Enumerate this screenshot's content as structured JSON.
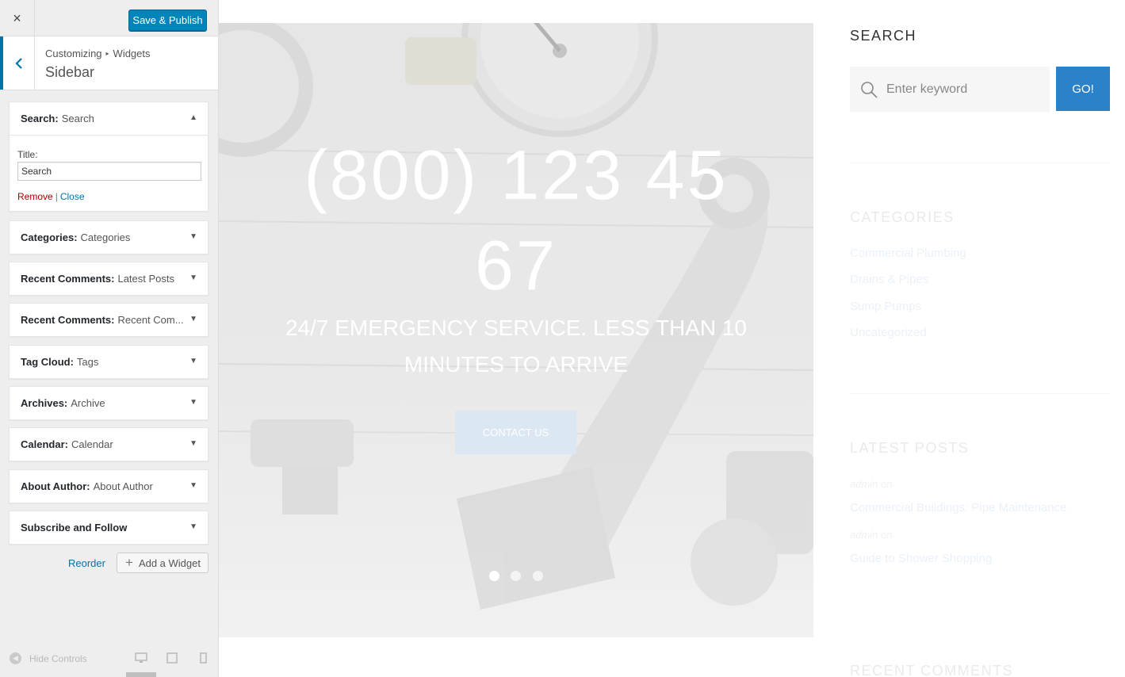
{
  "topbar": {
    "close_icon": "×",
    "save_label": "Save & Publish"
  },
  "header": {
    "back_icon": "chevron-left",
    "crumb_root": "Customizing",
    "crumb_sep": "▸",
    "crumb_current": "Widgets",
    "title": "Sidebar"
  },
  "widgets": [
    {
      "type": "Search:",
      "title": "Search",
      "expanded": true
    },
    {
      "type": "Categories:",
      "title": "Categories"
    },
    {
      "type": "Recent Comments:",
      "title": "Latest Posts"
    },
    {
      "type": "Recent Comments:",
      "title": "Recent Com..."
    },
    {
      "type": "Tag Cloud:",
      "title": "Tags"
    },
    {
      "type": "Archives:",
      "title": "Archive"
    },
    {
      "type": "Calendar:",
      "title": "Calendar"
    },
    {
      "type": "About Author:",
      "title": "About Author"
    },
    {
      "type": "Subscribe and Follow",
      "title": ""
    }
  ],
  "search_widget_form": {
    "title_label": "Title:",
    "title_value": "Search",
    "remove": "Remove",
    "pipe": "|",
    "close": "Close"
  },
  "actions": {
    "reorder": "Reorder",
    "add_widget": "Add a Widget"
  },
  "footer": {
    "hide_controls": "Hide Controls"
  },
  "preview": {
    "phone_line1": "(800) 123 45",
    "phone_line2": "67",
    "tagline_line1": "24/7 EMERGENCY SERVICE. LESS THAN 10",
    "tagline_line2": "MINUTES TO ARRIVE",
    "contact_button": "CONTACT US",
    "slides": 3,
    "active_slide": 1,
    "search_title": "SEARCH",
    "search_placeholder": "Enter keyword",
    "go_button": "GO!",
    "categories_title": "CATEGORIES",
    "categories": [
      "Commercial Plumbing",
      "Drains & Pipes",
      "Sump Pumps",
      "Uncategorized"
    ],
    "latest_posts_title": "LATEST POSTS",
    "posts": [
      {
        "meta": "admin   on",
        "title": "Commercial Buildings: Pipe Maintenance"
      },
      {
        "meta": "admin   on",
        "title": "Guide to Shower Shopping"
      }
    ],
    "recent_comments_title": "RECENT COMMENTS"
  },
  "colors": {
    "accent": "#0073aa",
    "publish": "#0085ba",
    "go": "#2b82c9",
    "remove": "#aa0000"
  }
}
